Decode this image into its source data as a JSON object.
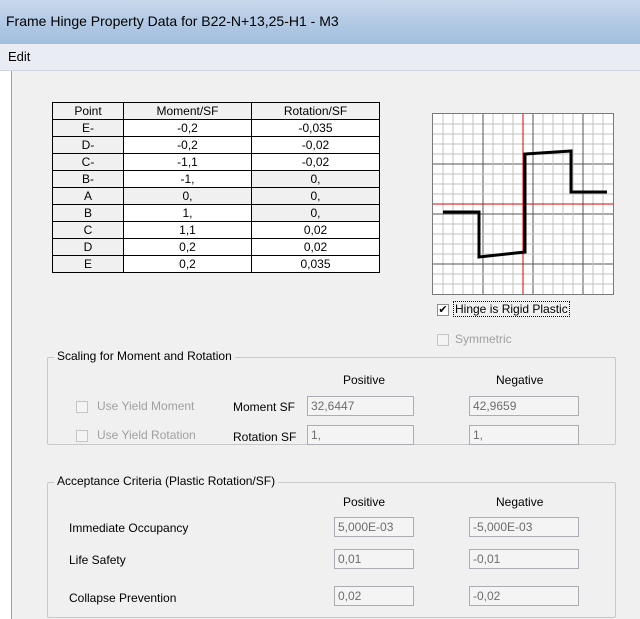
{
  "window": {
    "title": "Frame Hinge Property Data for B22-N+13,25-H1 - M3"
  },
  "menu": {
    "items": [
      "Edit"
    ]
  },
  "table": {
    "headers": [
      "Point",
      "Moment/SF",
      "Rotation/SF"
    ],
    "rows": [
      [
        "E-",
        "-0,2",
        "-0,035"
      ],
      [
        "D-",
        "-0,2",
        "-0,02"
      ],
      [
        "C-",
        "-1,1",
        "-0,02"
      ],
      [
        "B-",
        "-1,",
        "0,"
      ],
      [
        "A",
        "0,",
        "0,"
      ],
      [
        "B",
        "1,",
        "0,"
      ],
      [
        "C",
        "1,1",
        "0,02"
      ],
      [
        "D",
        "0,2",
        "0,02"
      ],
      [
        "E",
        "0,2",
        "0,035"
      ]
    ]
  },
  "options": {
    "rigid_plastic_label": "Hinge is Rigid Plastic",
    "rigid_plastic_checked": true,
    "symmetric_label": "Symmetric",
    "symmetric_checked": false
  },
  "scaling": {
    "title": "Scaling for Moment and Rotation",
    "positive_header": "Positive",
    "negative_header": "Negative",
    "use_yield_moment_label": "Use Yield Moment",
    "use_yield_rotation_label": "Use Yield Rotation",
    "moment_sf_label": "Moment SF",
    "rotation_sf_label": "Rotation SF",
    "moment_sf_pos": "32,6447",
    "moment_sf_neg": "42,9659",
    "rotation_sf_pos": "1,",
    "rotation_sf_neg": "1,"
  },
  "acceptance": {
    "title": "Acceptance Criteria (Plastic Rotation/SF)",
    "positive_header": "Positive",
    "negative_header": "Negative",
    "io_label": "Immediate Occupancy",
    "ls_label": "Life Safety",
    "cp_label": "Collapse Prevention",
    "io_pos": "5,000E-03",
    "io_neg": "-5,000E-03",
    "ls_pos": "0,01",
    "ls_neg": "-0,01",
    "cp_pos": "0,02",
    "cp_neg": "-0,02"
  },
  "colors": {
    "axis": "#e00000",
    "curve": "#000000",
    "grid": "#c0c0c0"
  }
}
